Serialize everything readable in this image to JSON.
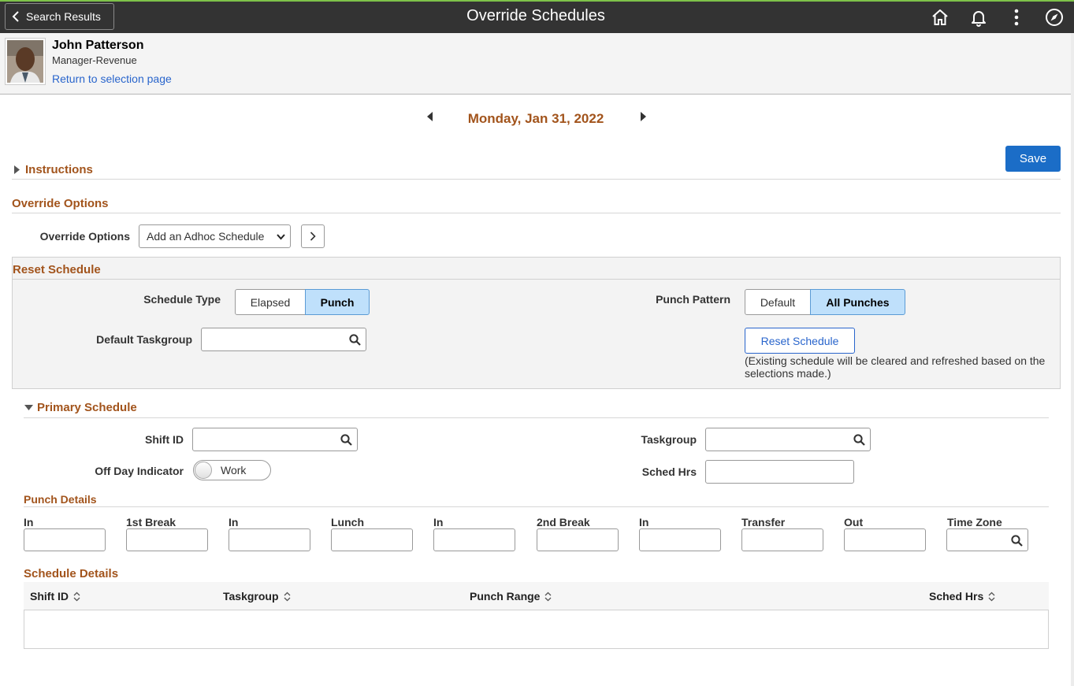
{
  "banner": {
    "back_label": "Search Results",
    "title": "Override Schedules",
    "icons": [
      "home-icon",
      "bell-icon",
      "more-vertical-icon",
      "compass-icon"
    ],
    "accent": "#7ec24a"
  },
  "employee": {
    "name": "John Patterson",
    "title": "Manager-Revenue",
    "return_link": "Return to selection page"
  },
  "date_nav": {
    "date": "Monday, Jan 31, 2022"
  },
  "actions": {
    "save_label": "Save"
  },
  "instructions": {
    "label": "Instructions"
  },
  "override_options": {
    "section_title": "Override Options",
    "field_label": "Override Options",
    "selected": "Add an Adhoc Schedule"
  },
  "reset_schedule": {
    "section_title": "Reset Schedule",
    "schedule_type_label": "Schedule Type",
    "schedule_type_options": [
      "Elapsed",
      "Punch"
    ],
    "schedule_type_selected": "Punch",
    "default_taskgroup_label": "Default Taskgroup",
    "punch_pattern_label": "Punch Pattern",
    "punch_pattern_options": [
      "Default",
      "All Punches"
    ],
    "punch_pattern_selected": "All Punches",
    "reset_button": "Reset Schedule",
    "note": "(Existing schedule will be cleared and refreshed based on the selections made.)"
  },
  "primary_schedule": {
    "section_title": "Primary Schedule",
    "shift_id_label": "Shift ID",
    "taskgroup_label": "Taskgroup",
    "off_day_label": "Off Day Indicator",
    "off_day_value": "Work",
    "sched_hrs_label": "Sched Hrs"
  },
  "punch_details": {
    "section_title": "Punch Details",
    "columns": [
      "In",
      "1st Break",
      "In",
      "Lunch",
      "In",
      "2nd Break",
      "In",
      "Transfer",
      "Out",
      "Time Zone"
    ]
  },
  "schedule_details": {
    "section_title": "Schedule Details",
    "columns": [
      "Shift ID",
      "Taskgroup",
      "Punch Range",
      "Sched Hrs"
    ],
    "rows": []
  },
  "colors": {
    "section_title": "#a2541c",
    "primary_button": "#1b6dc7",
    "link": "#2965cc",
    "selected_segment": "#bfe0fb"
  }
}
